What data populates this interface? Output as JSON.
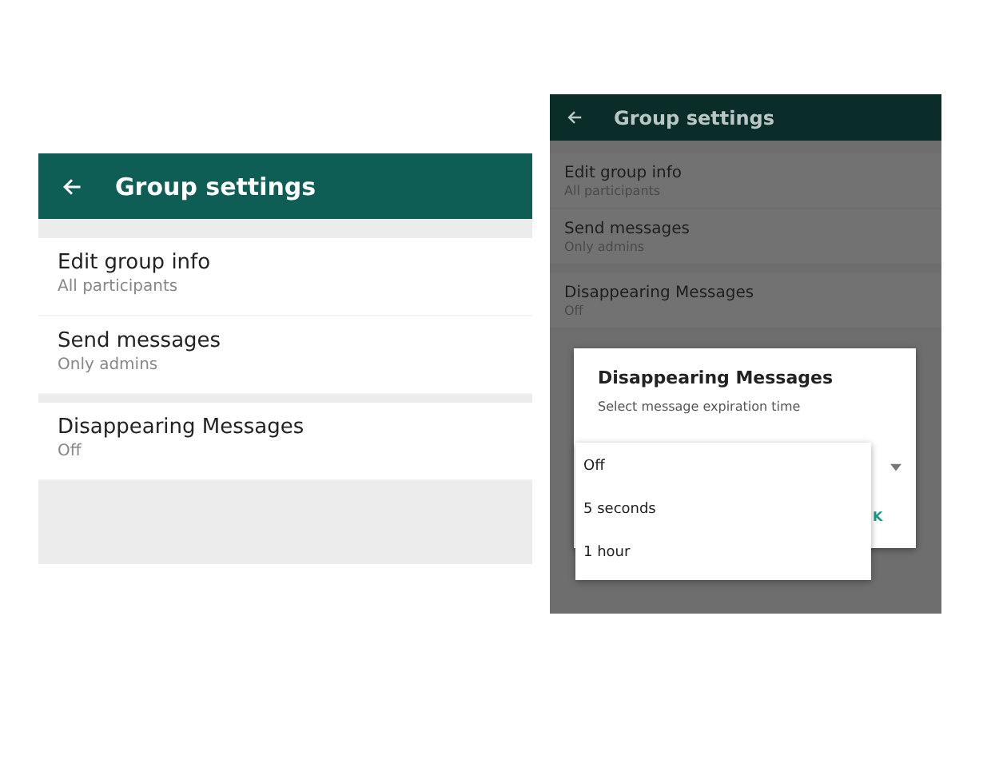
{
  "panels": [
    {
      "dimmed": false,
      "header": {
        "title": "Group settings"
      },
      "sections": [
        [
          {
            "title": "Edit group info",
            "subtitle": "All participants"
          },
          {
            "title": "Send messages",
            "subtitle": "Only admins"
          }
        ],
        [
          {
            "title": "Disappearing Messages",
            "subtitle": "Off"
          }
        ]
      ]
    },
    {
      "dimmed": true,
      "header": {
        "title": "Group settings"
      },
      "sections": [
        [
          {
            "title": "Edit group info",
            "subtitle": "All participants"
          },
          {
            "title": "Send messages",
            "subtitle": "Only admins"
          }
        ],
        [
          {
            "title": "Disappearing Messages",
            "subtitle": "Off"
          }
        ]
      ],
      "dialog": {
        "title": "Disappearing Messages",
        "subtitle": "Select message expiration time",
        "button": "K",
        "menu": [
          "Off",
          "5 seconds",
          "1 hour"
        ]
      }
    }
  ]
}
